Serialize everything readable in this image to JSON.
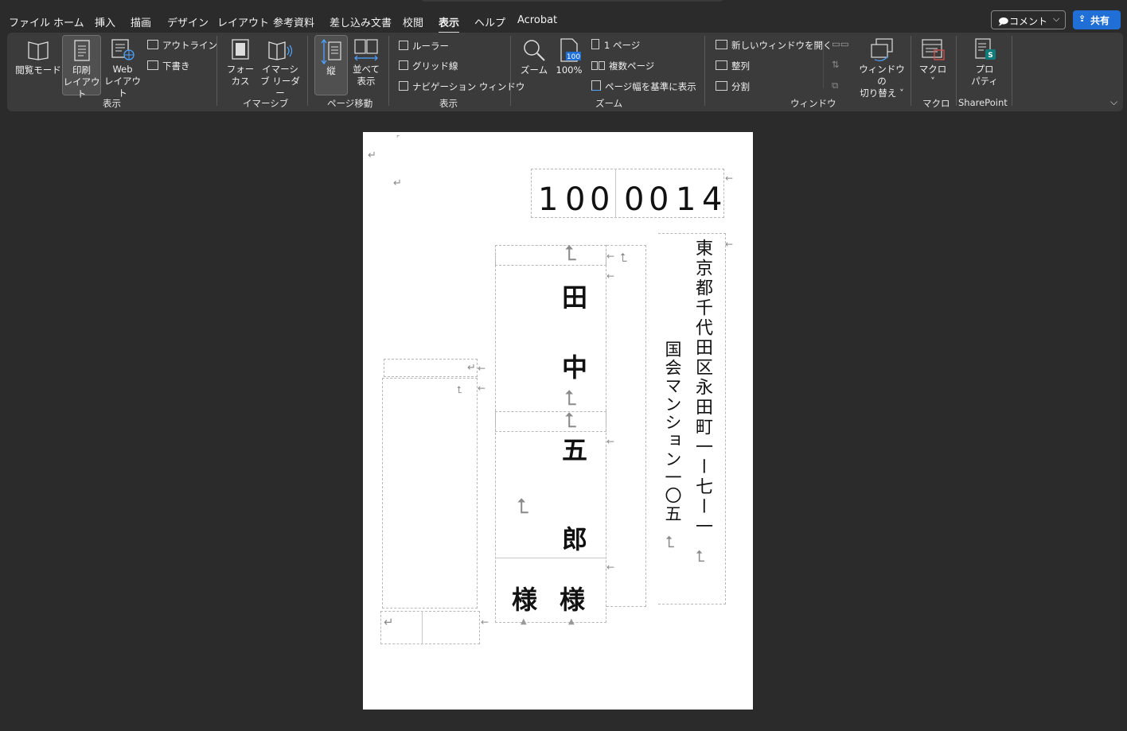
{
  "menu": {
    "tabs": [
      "ファイル",
      "ホーム",
      "挿入",
      "描画",
      "デザイン",
      "レイアウト",
      "参考資料",
      "差し込み文書",
      "校閲",
      "表示",
      "ヘルプ",
      "Acrobat"
    ],
    "active_tab": "表示",
    "comment_label": "コメント",
    "share_label": "共有"
  },
  "ribbon": {
    "views": {
      "read_mode": "閲覧モード",
      "print_layout_1": "印刷",
      "print_layout_2": "レイアウト",
      "web_layout_1": "Web",
      "web_layout_2": "レイアウト",
      "outline": "アウトライン",
      "draft": "下書き",
      "group": "表示"
    },
    "immersive": {
      "focus_1": "フォー",
      "focus_2": "カス",
      "reader_1": "イマーシ",
      "reader_2": "ブ リーダー",
      "group": "イマーシブ"
    },
    "page_movement": {
      "vertical": "縦",
      "side_1": "並べて",
      "side_2": "表示",
      "group": "ページ移動"
    },
    "show": {
      "ruler": "ルーラー",
      "gridlines": "グリッド線",
      "nav_pane": "ナビゲーション ウィンドウ",
      "group": "表示"
    },
    "zoom": {
      "zoom": "ズーム",
      "hundred": "100%",
      "hundred_icon": "100",
      "one_page": "1 ページ",
      "multiple_pages": "複数ページ",
      "page_width": "ページ幅を基準に表示",
      "group": "ズーム"
    },
    "window": {
      "new_window": "新しいウィンドウを開く",
      "arrange": "整列",
      "split": "分割",
      "switch_1": "ウィンドウの",
      "switch_2": "切り替え ˅",
      "group": "ウィンドウ"
    },
    "macros": {
      "label": "マクロ",
      "chev": "˅",
      "group": "マクロ"
    },
    "sharepoint": {
      "prop_1": "プロ",
      "prop_2": "パティ",
      "group": "SharePoint",
      "badge": "S"
    }
  },
  "document": {
    "postal_code": [
      "1",
      "0",
      "0",
      "0",
      "0",
      "1",
      "4"
    ],
    "address_line1": "東京都千代田区永田町一ー七ー一",
    "address_line2": "国会マンション一〇五",
    "name_chars": [
      "田",
      "中",
      "五",
      "郎"
    ],
    "honorific": "様",
    "return_mark": "↵",
    "anchor_mark": "⮤",
    "arrow_mark": "←"
  }
}
